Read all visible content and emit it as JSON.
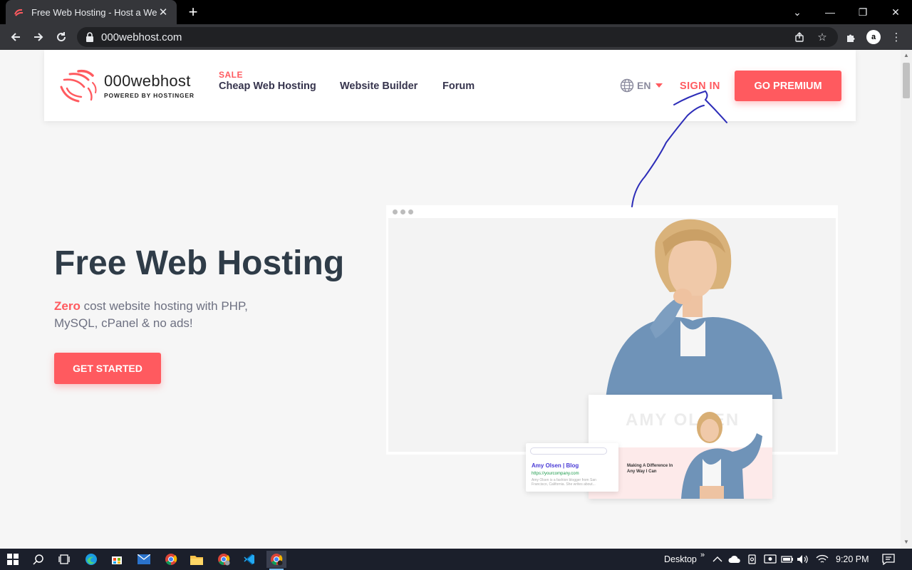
{
  "browser": {
    "tab_title": "Free Web Hosting - Host a Websi",
    "tab_close": "✕",
    "new_tab": "+",
    "url": "000webhost.com",
    "profile_letter": "a",
    "window_controls": {
      "minimize": "—",
      "restore": "❐",
      "close": "✕",
      "tab_search": "⌄"
    }
  },
  "header": {
    "logo_name": "000webhost",
    "logo_powered": "POWERED BY HOSTINGER",
    "sale_label": "SALE",
    "nav": {
      "cheap_hosting": "Cheap Web Hosting",
      "website_builder": "Website Builder",
      "forum": "Forum"
    },
    "language": "EN",
    "sign_in": "SIGN IN",
    "go_premium": "GO PREMIUM"
  },
  "hero": {
    "title": "Free Web Hosting",
    "subtitle_highlight": "Zero",
    "subtitle_rest": " cost website hosting with PHP, MySQL, cPanel & no ads!",
    "cta": "GET STARTED"
  },
  "illustration": {
    "blog_big_name": "AMY OLSEN",
    "blog_tagline": "Making A Difference In Any Way I Can",
    "search_title": "Amy Olsen | Blog",
    "search_url": "https://yourcompany.com",
    "search_snippet": "Amy Olsen is a fashion blogger from San Francisco, California. She writes about..."
  },
  "taskbar": {
    "desktop_label": "Desktop",
    "time": "9:20 PM",
    "chevron": "»"
  },
  "colors": {
    "accent": "#ff5a5f",
    "heading": "#2f3c48",
    "nav_text": "#36344d",
    "annotation_ink": "#2d2db8"
  }
}
